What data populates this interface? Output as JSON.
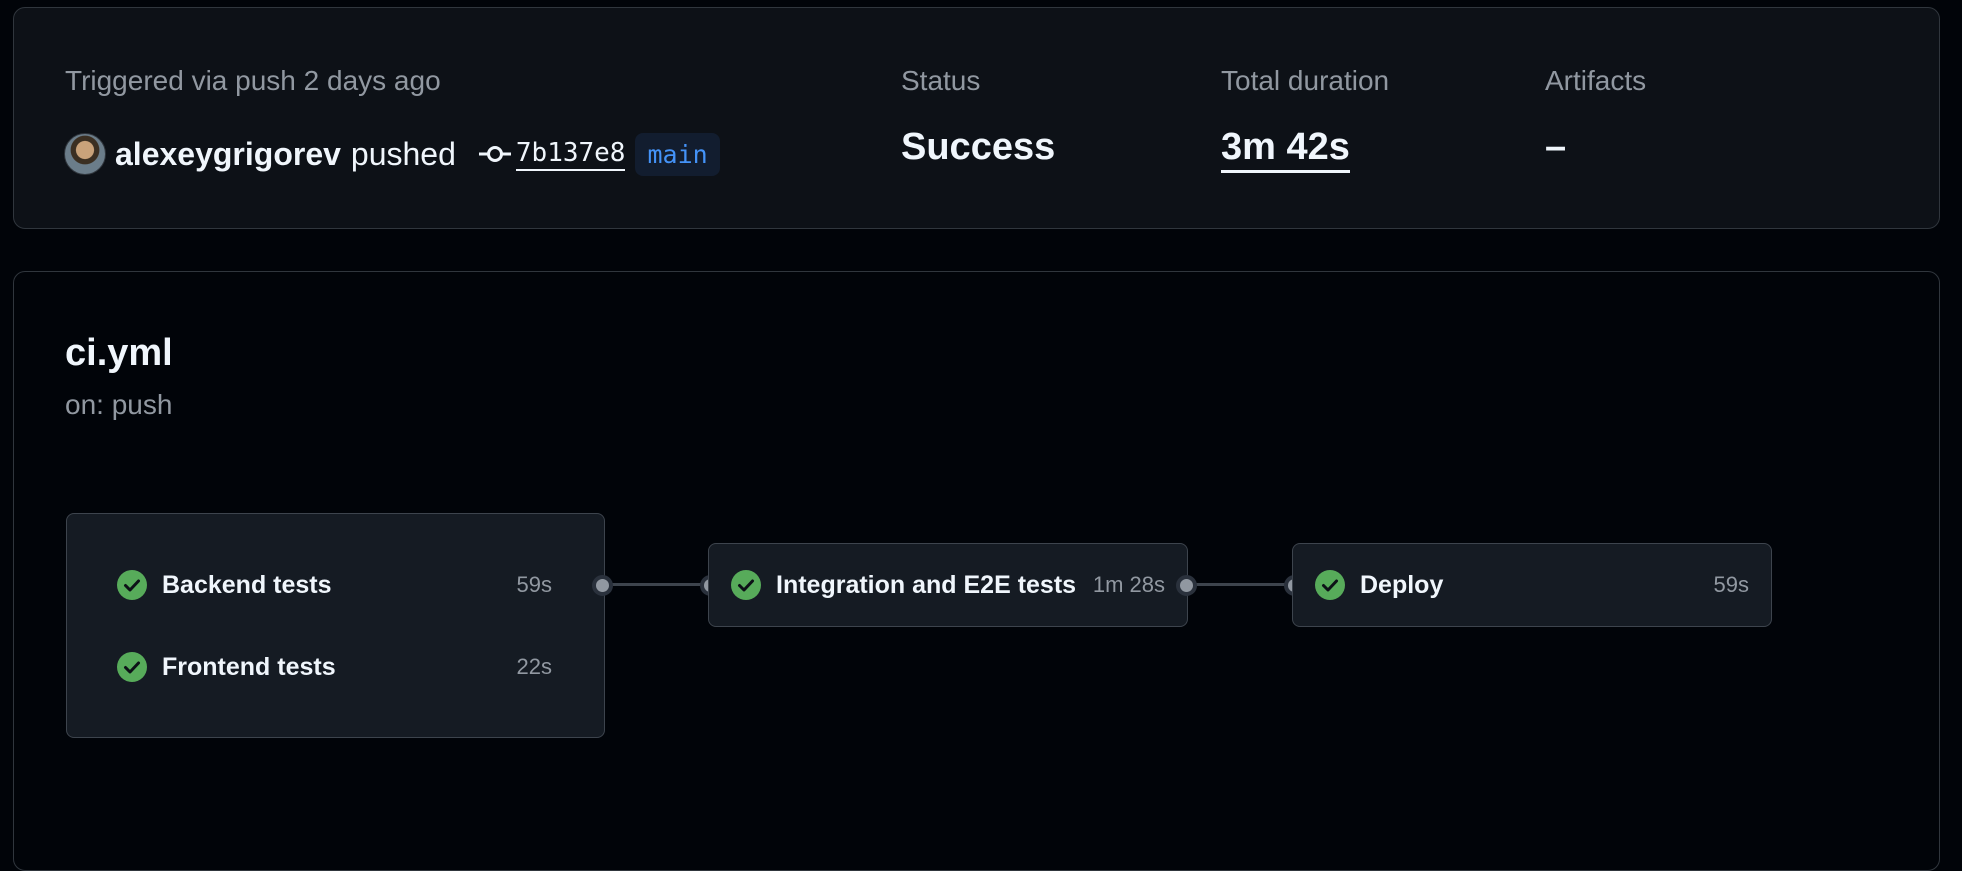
{
  "summary": {
    "trigger_label": "Triggered via push 2 days ago",
    "actor": "alexeygrigorev",
    "action": "pushed",
    "commit_sha": "7b137e8",
    "branch": "main",
    "status_label": "Status",
    "status_value": "Success",
    "duration_label": "Total duration",
    "duration_value": "3m 42s",
    "artifacts_label": "Artifacts",
    "artifacts_value": "–"
  },
  "workflow": {
    "file": "ci.yml",
    "event": "on: push",
    "jobs": [
      {
        "name": "Backend tests",
        "duration": "59s",
        "status": "success"
      },
      {
        "name": "Frontend tests",
        "duration": "22s",
        "status": "success"
      },
      {
        "name": "Integration and E2E tests",
        "duration": "1m 28s",
        "status": "success"
      },
      {
        "name": "Deploy",
        "duration": "59s",
        "status": "success"
      }
    ]
  },
  "icons": {
    "avatar": "user-avatar",
    "commit": "git-commit-icon",
    "success": "check-circle-fill-icon"
  },
  "colors": {
    "success": "#57ab5a",
    "branch_text": "#4493f8",
    "branch_bg": "#121d2f"
  }
}
